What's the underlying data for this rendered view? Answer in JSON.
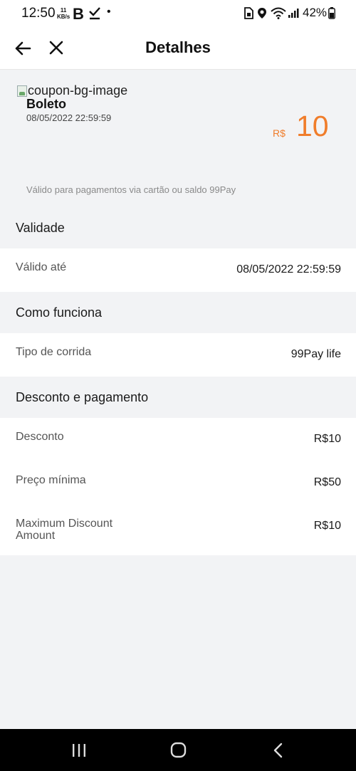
{
  "status_bar": {
    "time": "12:50",
    "kbs_value": "11",
    "kbs_unit": "KB/s",
    "b_icon_label": "B",
    "battery": "42%",
    "icons": [
      "check-icon",
      "dot-icon",
      "sim-icon",
      "location-icon",
      "wifi-icon",
      "signal-icon",
      "battery-icon"
    ]
  },
  "nav": {
    "title": "Detalhes",
    "back_icon": "arrow-left-icon",
    "close_icon": "close-icon"
  },
  "coupon": {
    "image_alt": "coupon-bg-image",
    "title": "Boleto",
    "date": "08/05/2022 22:59:59",
    "currency": "R$",
    "amount": "10",
    "note": "Válido para pagamentos via cartão ou saldo 99Pay",
    "accent_color": "#f07d2b"
  },
  "sections": {
    "validity": {
      "title": "Validade",
      "rows": [
        {
          "label": "Válido até",
          "value": "08/05/2022 22:59:59"
        }
      ]
    },
    "how_it_works": {
      "title": "Como funciona",
      "rows": [
        {
          "label": "Tipo de corrida",
          "value": "99Pay life"
        }
      ]
    },
    "discount_payment": {
      "title": "Desconto e pagamento",
      "rows": [
        {
          "label": "Desconto",
          "value": "R$10"
        },
        {
          "label": "Preço mínima",
          "value": "R$50"
        },
        {
          "label": "Maximum Discount Amount",
          "value": "R$10"
        }
      ]
    }
  },
  "android_nav": {
    "icons": [
      "recent-apps-icon",
      "home-icon",
      "back-icon"
    ]
  }
}
